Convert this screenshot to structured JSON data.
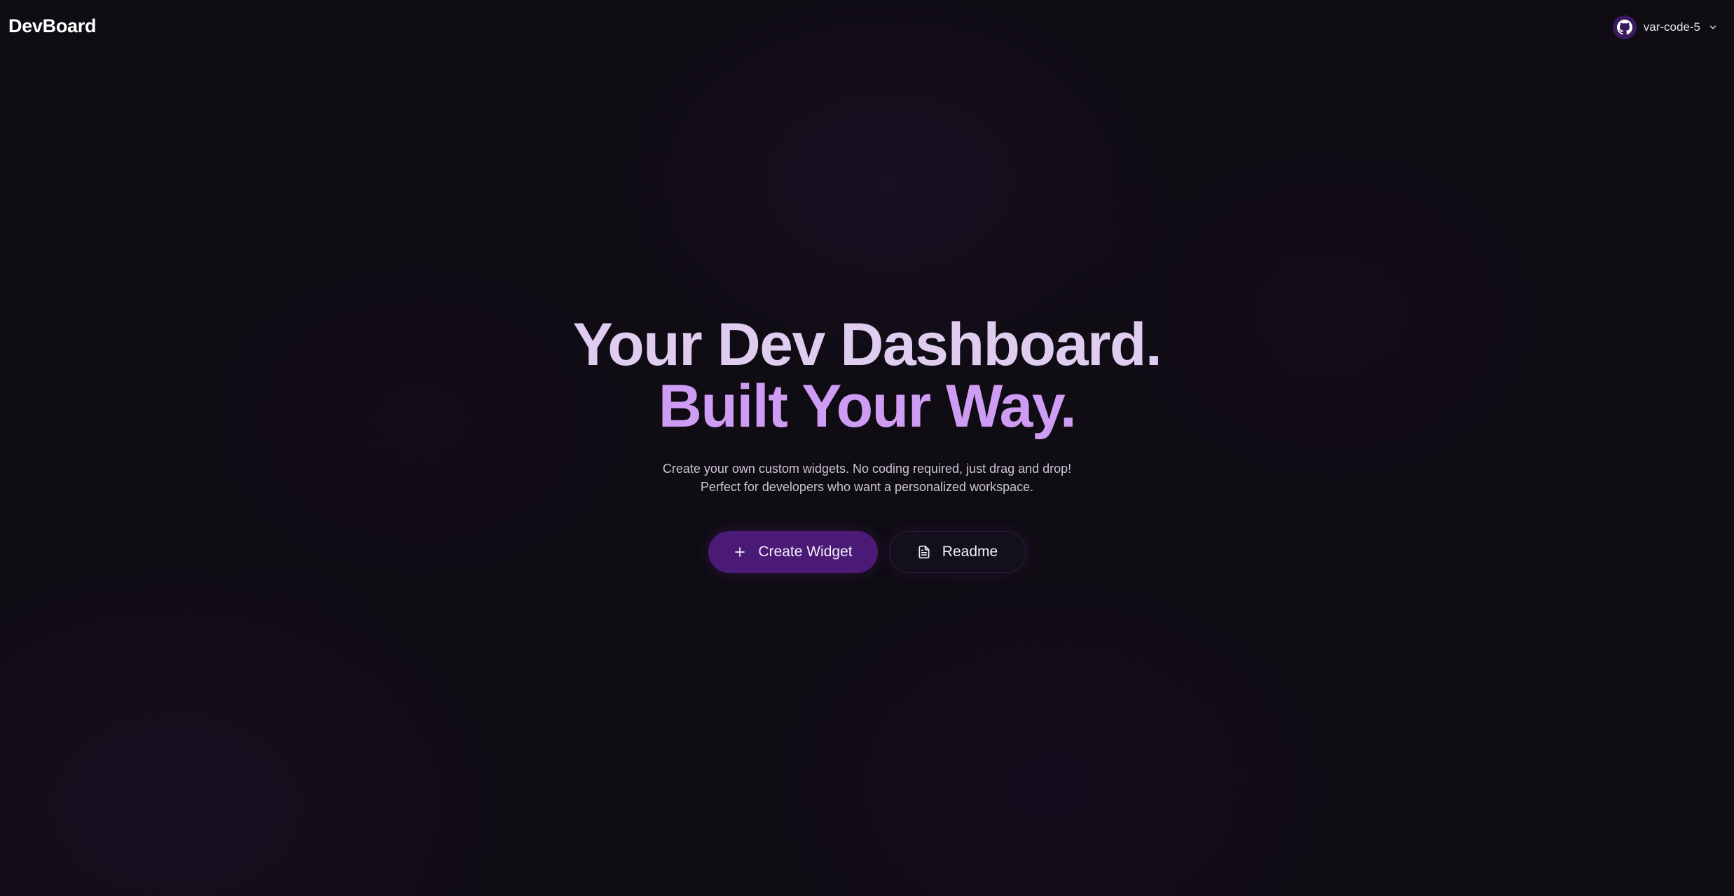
{
  "app": {
    "brand": "DevBoard"
  },
  "user_menu": {
    "username": "var-code-5",
    "avatar_icon": "github-icon",
    "dropdown_icon": "chevron-down-icon"
  },
  "hero": {
    "headline_line1": "Your Dev Dashboard.",
    "headline_line2": "Built Your Way.",
    "subtitle": "Create your own custom widgets. No coding required, just drag and drop! Perfect for developers who want a personalized workspace."
  },
  "actions": {
    "create_label": "Create Widget",
    "create_icon": "plus-icon",
    "readme_label": "Readme",
    "readme_icon": "document-icon"
  },
  "colors": {
    "background": "#0f0c13",
    "headline_primary": "#dfcdf0",
    "headline_accent": "#cf9cf3",
    "button_primary": "#4b1a76",
    "button_secondary": "#130f1c"
  }
}
